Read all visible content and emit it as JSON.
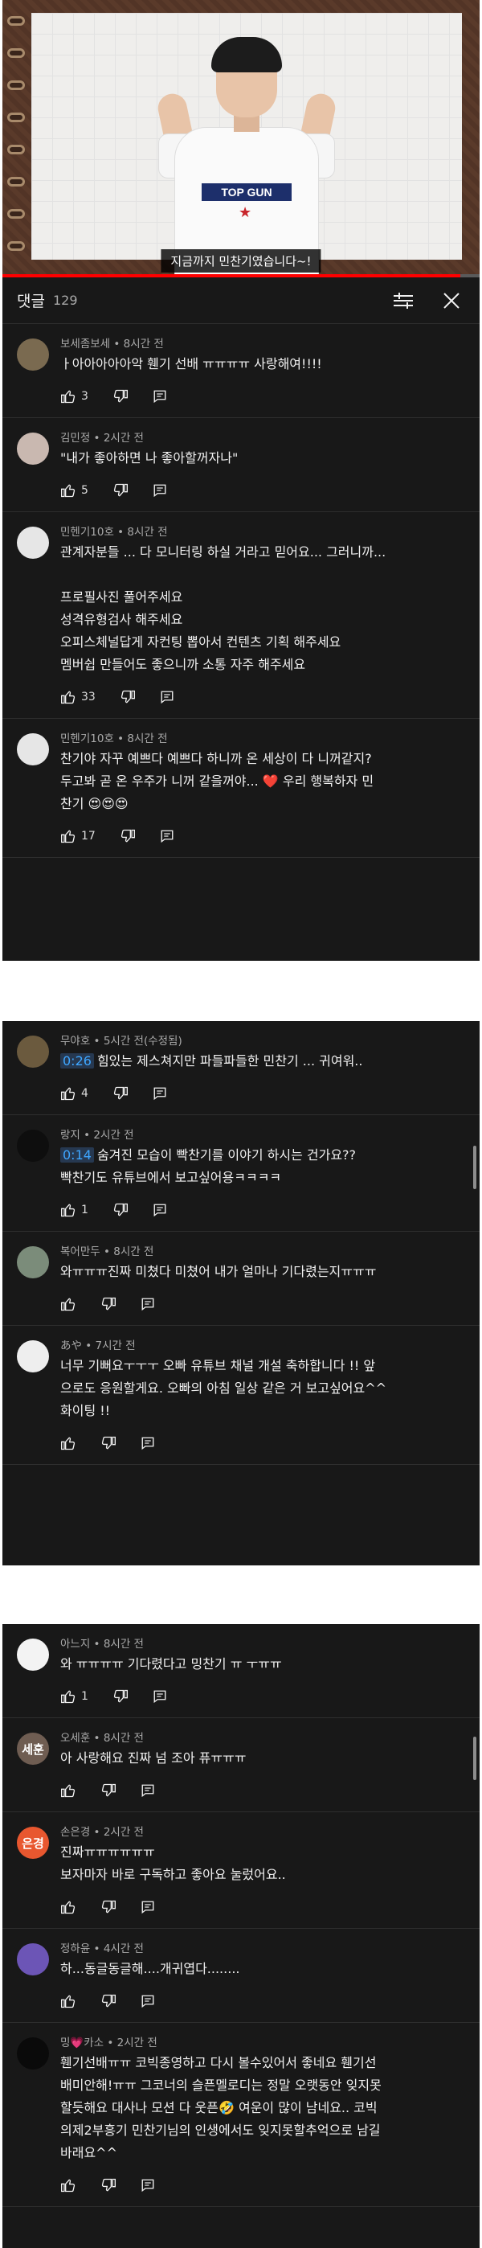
{
  "video": {
    "caption": "지금까지 민찬기였습니다~!",
    "shirt_logo": "TOP GUN",
    "progress_percent": 96
  },
  "comments_header": {
    "title": "댓글",
    "count": "129",
    "sort_icon": "sliders-icon",
    "close_icon": "close-icon"
  },
  "panel1": [
    {
      "author": "보세좀보세",
      "time": "8시간 전",
      "lines": [
        "ㅏ아아아아아악 휀기 선배 ㅠㅠㅠㅠ 사랑해여!!!!"
      ],
      "likes": "3",
      "avatar_color": "#7a6a50",
      "avatar_text": ""
    },
    {
      "author": "김민정",
      "time": "2시간 전",
      "lines": [
        "\"내가 좋아하면 나 좋아할꺼자나\""
      ],
      "likes": "5",
      "avatar_color": "#c9b8b0",
      "avatar_text": ""
    },
    {
      "author": "민헨기10호",
      "time": "8시간 전",
      "lines": [
        "관계자분들 ... 다 모니터링 하실 거라고 믿어요... 그러니까...",
        "",
        "프로필사진 풀어주세요",
        "성격유형검사 해주세요",
        "오피스체널답게 자컨팅 뽑아서 컨텐츠 기획 해주세요",
        "멤버쉽 만들어도 좋으니까 소통 자주 해주세요"
      ],
      "likes": "33",
      "avatar_color": "#e6e6e6",
      "avatar_text": ""
    },
    {
      "author": "민헨기10호",
      "time": "8시간 전",
      "lines": [
        "찬기야 자꾸 예쁘다 예쁘다 하니까 온 세상이 다 니꺼같지?",
        "두고봐 곧 온 우주가 니꺼 같을꺼야... ❤️ 우리 행복하자 민",
        "찬기 😍😍😍"
      ],
      "likes": "17",
      "avatar_color": "#e6e6e6",
      "avatar_text": ""
    }
  ],
  "panel2": [
    {
      "author": "무야호",
      "time": "5시간 전(수정됨)",
      "timestamp": "0:26",
      "lines": [
        "힘있는 제스쳐지만 파들파들한 민찬기 ... 귀여워.."
      ],
      "likes": "4",
      "avatar_color": "#6b5a3e",
      "avatar_text": ""
    },
    {
      "author": "랑지",
      "time": "2시간 전",
      "timestamp": "0:14",
      "lines": [
        "숨겨진 모습이 빡찬기를 이야기 하시는 건가요??",
        "빡찬기도 유튜브에서 보고싶어용ㅋㅋㅋㅋ"
      ],
      "likes": "1",
      "avatar_color": "#0e0e0e",
      "avatar_text": ""
    },
    {
      "author": "복어만두",
      "time": "8시간 전",
      "lines": [
        "와ㅠㅠㅠ진짜 미쳤다 미쳤어 내가 얼마나 기다렸는지ㅠㅠㅠ"
      ],
      "likes": "",
      "avatar_color": "#7b8c7a",
      "avatar_text": ""
    },
    {
      "author": "あや",
      "time": "7시간 전",
      "lines": [
        "너무 기뻐요ㅜㅜㅜ 오빠 유튜브 채널 개설 축하합니다 !! 앞",
        "으로도 응원할게요. 오빠의 아침 일상 같은 거 보고싶어요^^",
        "화이팅 !!"
      ],
      "likes": "",
      "avatar_color": "#eeeeee",
      "avatar_text": ""
    }
  ],
  "panel3": [
    {
      "author": "아느지",
      "time": "8시간 전",
      "lines": [
        "와 ㅠㅠㅠㅠ 기다렸다고 밍찬기 ㅠ ㅜㅠㅠ"
      ],
      "likes": "1",
      "avatar_color": "#f3f3f3",
      "avatar_text": ""
    },
    {
      "author": "오세훈",
      "time": "8시간 전",
      "lines": [
        "아 사랑해요 진짜 넘 조아 퓨ㅠㅠㅠ"
      ],
      "likes": "",
      "avatar_color": "#6f5d52",
      "avatar_text": "세훈"
    },
    {
      "author": "손은경",
      "time": "2시간 전",
      "lines": [
        "진짜ㅠㅠㅠㅠㅠㅠ",
        "보자마자 바로 구독하고 좋아요 눌렀어요.."
      ],
      "likes": "",
      "avatar_color": "#e8572f",
      "avatar_text": "은경"
    },
    {
      "author": "정하윤",
      "time": "4시간 전",
      "lines": [
        "하...동글동글해....개귀엽다........"
      ],
      "likes": "",
      "avatar_color": "#6c55b6",
      "avatar_text": ""
    },
    {
      "author": "밍💗카소",
      "time": "2시간 전",
      "lines": [
        "휀기선배ㅠㅠ 코빅종영하고 다시 볼수있어서  좋네요 휀기선",
        "배미안해!ㅠㅠ 그코너의 슬픈멜로디는 정말 오랫동안 잊지못",
        "할듯해요 대사나 모션 다 웃픈🤣 여운이 많이 남네요.. 코빅",
        "의제2부흥기 민찬기님의 인생에서도 잊지못할추억으로 남길",
        "바래요^^"
      ],
      "likes": "",
      "avatar_color": "#0a0a0a",
      "avatar_text": ""
    }
  ],
  "labels": {
    "like_icon": "thumbs-up-icon",
    "dislike_icon": "thumbs-down-icon",
    "reply_icon": "reply-icon"
  }
}
